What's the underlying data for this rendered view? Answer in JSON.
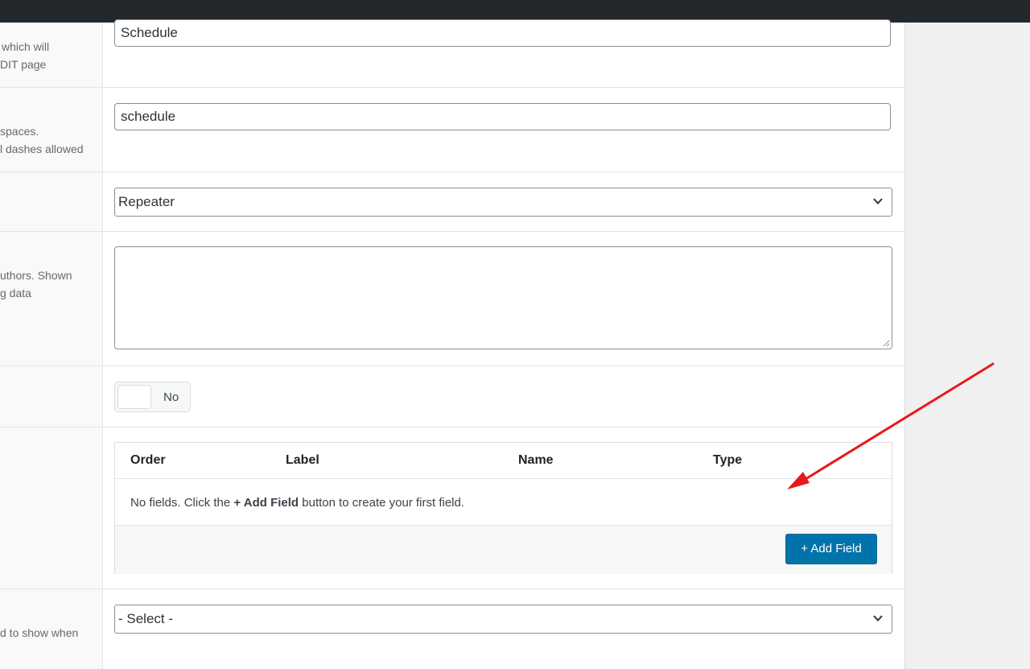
{
  "rows": {
    "title": {
      "desc_lines": [
        "which will",
        "DIT page"
      ],
      "value": "Schedule"
    },
    "name": {
      "desc_lines": [
        "spaces.",
        "l dashes allowed"
      ],
      "value": "schedule"
    },
    "type": {
      "selected": "Repeater"
    },
    "instructions": {
      "desc_lines": [
        "uthors. Shown",
        "g data"
      ],
      "value": ""
    },
    "required": {
      "toggle_label": "No"
    },
    "sub_fields": {
      "columns": [
        "Order",
        "Label",
        "Name",
        "Type"
      ],
      "empty_prefix": "No fields. Click the ",
      "empty_bold": "+ Add Field",
      "empty_suffix": " button to create your first field.",
      "add_button": "+ Add Field"
    },
    "layout": {
      "desc_lines": [
        "d to show when"
      ],
      "selected": "- Select -"
    }
  },
  "colors": {
    "accent": "#0073aa",
    "topbar": "#23282d",
    "annotation_arrow": "#e8191b"
  }
}
